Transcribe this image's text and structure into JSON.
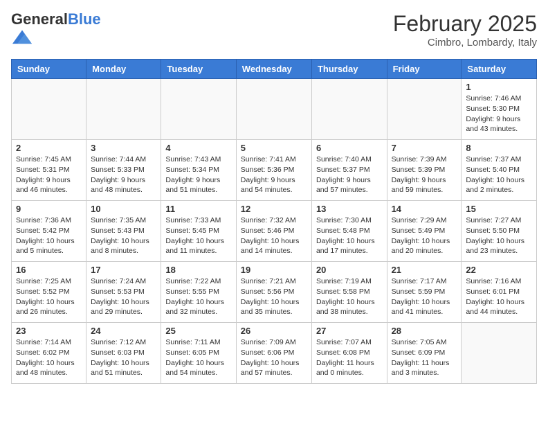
{
  "header": {
    "logo_general": "General",
    "logo_blue": "Blue",
    "month_year": "February 2025",
    "location": "Cimbro, Lombardy, Italy"
  },
  "weekdays": [
    "Sunday",
    "Monday",
    "Tuesday",
    "Wednesday",
    "Thursday",
    "Friday",
    "Saturday"
  ],
  "weeks": [
    [
      {
        "day": "",
        "info": ""
      },
      {
        "day": "",
        "info": ""
      },
      {
        "day": "",
        "info": ""
      },
      {
        "day": "",
        "info": ""
      },
      {
        "day": "",
        "info": ""
      },
      {
        "day": "",
        "info": ""
      },
      {
        "day": "1",
        "info": "Sunrise: 7:46 AM\nSunset: 5:30 PM\nDaylight: 9 hours and 43 minutes."
      }
    ],
    [
      {
        "day": "2",
        "info": "Sunrise: 7:45 AM\nSunset: 5:31 PM\nDaylight: 9 hours and 46 minutes."
      },
      {
        "day": "3",
        "info": "Sunrise: 7:44 AM\nSunset: 5:33 PM\nDaylight: 9 hours and 48 minutes."
      },
      {
        "day": "4",
        "info": "Sunrise: 7:43 AM\nSunset: 5:34 PM\nDaylight: 9 hours and 51 minutes."
      },
      {
        "day": "5",
        "info": "Sunrise: 7:41 AM\nSunset: 5:36 PM\nDaylight: 9 hours and 54 minutes."
      },
      {
        "day": "6",
        "info": "Sunrise: 7:40 AM\nSunset: 5:37 PM\nDaylight: 9 hours and 57 minutes."
      },
      {
        "day": "7",
        "info": "Sunrise: 7:39 AM\nSunset: 5:39 PM\nDaylight: 9 hours and 59 minutes."
      },
      {
        "day": "8",
        "info": "Sunrise: 7:37 AM\nSunset: 5:40 PM\nDaylight: 10 hours and 2 minutes."
      }
    ],
    [
      {
        "day": "9",
        "info": "Sunrise: 7:36 AM\nSunset: 5:42 PM\nDaylight: 10 hours and 5 minutes."
      },
      {
        "day": "10",
        "info": "Sunrise: 7:35 AM\nSunset: 5:43 PM\nDaylight: 10 hours and 8 minutes."
      },
      {
        "day": "11",
        "info": "Sunrise: 7:33 AM\nSunset: 5:45 PM\nDaylight: 10 hours and 11 minutes."
      },
      {
        "day": "12",
        "info": "Sunrise: 7:32 AM\nSunset: 5:46 PM\nDaylight: 10 hours and 14 minutes."
      },
      {
        "day": "13",
        "info": "Sunrise: 7:30 AM\nSunset: 5:48 PM\nDaylight: 10 hours and 17 minutes."
      },
      {
        "day": "14",
        "info": "Sunrise: 7:29 AM\nSunset: 5:49 PM\nDaylight: 10 hours and 20 minutes."
      },
      {
        "day": "15",
        "info": "Sunrise: 7:27 AM\nSunset: 5:50 PM\nDaylight: 10 hours and 23 minutes."
      }
    ],
    [
      {
        "day": "16",
        "info": "Sunrise: 7:25 AM\nSunset: 5:52 PM\nDaylight: 10 hours and 26 minutes."
      },
      {
        "day": "17",
        "info": "Sunrise: 7:24 AM\nSunset: 5:53 PM\nDaylight: 10 hours and 29 minutes."
      },
      {
        "day": "18",
        "info": "Sunrise: 7:22 AM\nSunset: 5:55 PM\nDaylight: 10 hours and 32 minutes."
      },
      {
        "day": "19",
        "info": "Sunrise: 7:21 AM\nSunset: 5:56 PM\nDaylight: 10 hours and 35 minutes."
      },
      {
        "day": "20",
        "info": "Sunrise: 7:19 AM\nSunset: 5:58 PM\nDaylight: 10 hours and 38 minutes."
      },
      {
        "day": "21",
        "info": "Sunrise: 7:17 AM\nSunset: 5:59 PM\nDaylight: 10 hours and 41 minutes."
      },
      {
        "day": "22",
        "info": "Sunrise: 7:16 AM\nSunset: 6:01 PM\nDaylight: 10 hours and 44 minutes."
      }
    ],
    [
      {
        "day": "23",
        "info": "Sunrise: 7:14 AM\nSunset: 6:02 PM\nDaylight: 10 hours and 48 minutes."
      },
      {
        "day": "24",
        "info": "Sunrise: 7:12 AM\nSunset: 6:03 PM\nDaylight: 10 hours and 51 minutes."
      },
      {
        "day": "25",
        "info": "Sunrise: 7:11 AM\nSunset: 6:05 PM\nDaylight: 10 hours and 54 minutes."
      },
      {
        "day": "26",
        "info": "Sunrise: 7:09 AM\nSunset: 6:06 PM\nDaylight: 10 hours and 57 minutes."
      },
      {
        "day": "27",
        "info": "Sunrise: 7:07 AM\nSunset: 6:08 PM\nDaylight: 11 hours and 0 minutes."
      },
      {
        "day": "28",
        "info": "Sunrise: 7:05 AM\nSunset: 6:09 PM\nDaylight: 11 hours and 3 minutes."
      },
      {
        "day": "",
        "info": ""
      }
    ]
  ]
}
